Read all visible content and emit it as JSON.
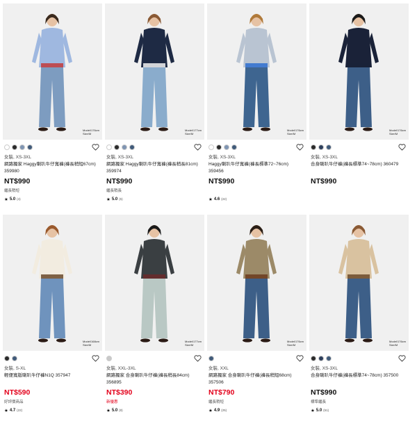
{
  "colors": {
    "sale_red": "#e3001b",
    "photo_bg": "#f0f0f0"
  },
  "products": [
    {
      "swatches": [
        "#ffffff",
        "#2b2b2b",
        "#7f95b3",
        "#415b7a"
      ],
      "sizes": "女裝, XS-3XL",
      "name": "網路獨家 Haggy喇叭牛仔寬褲(褲長稍短67cm) 359980",
      "price": "NT$990",
      "sale": false,
      "tag": "繼長稍短",
      "rating": "5.0",
      "reviews": "(4)",
      "model_note": "Model/176cm\nSize/M",
      "figure": {
        "top": "#9fb8e0",
        "bottom": "#7d9cc0",
        "hair": "#3a2a1e",
        "accent": "#c23a3a"
      }
    },
    {
      "swatches": [
        "#ffffff",
        "#2b2b2b",
        "#7f95b3",
        "#415b7a"
      ],
      "sizes": "女裝, XS-3XL",
      "name": "網路獨家 Haggy喇叭牛仔寬褲(褲長稍長81cm) 359974",
      "price": "NT$990",
      "sale": false,
      "tag": "繼長稍長",
      "rating": "5.0",
      "reviews": "(5)",
      "model_note": "Model/177cm\nSize/M",
      "figure": {
        "top": "#1e2a44",
        "bottom": "#8aaccc",
        "hair": "#8a5a35",
        "accent": "#f2f2f2"
      }
    },
    {
      "swatches": [
        "#ffffff",
        "#2b2b2b",
        "#7f95b3",
        "#415b7a"
      ],
      "sizes": "女裝, XS-3XL",
      "name": "Haggy喇叭牛仔寬褲(褲長標準72~76cm) 359456",
      "price": "NT$990",
      "sale": false,
      "tag": "",
      "rating": "4.6",
      "reviews": "(22)",
      "model_note": "Model/176cm\nSize/M",
      "figure": {
        "top": "#b9c4d2",
        "bottom": "#3e6590",
        "hair": "#b07a3a",
        "accent": "#2e6fd0"
      }
    },
    {
      "swatches": [
        "#2b2b2b",
        "#2e3f5c",
        "#415b7a"
      ],
      "sizes": "女裝, XS-3XL",
      "name": "合身喇叭牛仔褲(褲長標準74~78cm) 360479",
      "price": "NT$990",
      "sale": false,
      "tag": "",
      "rating": "",
      "reviews": "",
      "model_note": "Model/176cm\nSize/M",
      "figure": {
        "top": "#1a2238",
        "bottom": "#3d5f88",
        "hair": "#1a1a1a",
        "accent": "#1a2238"
      }
    },
    {
      "swatches": [
        "#2b2b2b",
        "#415b7a"
      ],
      "sizes": "女裝, S-XL",
      "name": "輕便寬版喇叭牛仔褲N1Q 357947",
      "price": "NT$590",
      "sale": true,
      "tag": "好評價商品",
      "rating": "4.7",
      "reviews": "(22)",
      "model_note": "Model/168cm\nSize/M",
      "figure": {
        "top": "#f2ece0",
        "bottom": "#6f93bd",
        "hair": "#9a5a2e",
        "accent": "#6b4a2a"
      }
    },
    {
      "swatches": [
        "#c9c9c9"
      ],
      "sizes": "女裝, XXL-3XL",
      "name": "網路獨家 合身喇叭牛仔褲(褲長稍長84cm) 356895",
      "price": "NT$390",
      "sale": true,
      "tag": "新優惠",
      "rating": "5.0",
      "reviews": "(8)",
      "model_note": "Model/177cm\nSize/M",
      "figure": {
        "top": "#3a3f42",
        "bottom": "#b9c8c4",
        "hair": "#1a1a1a",
        "accent": "#6b2a2a"
      }
    },
    {
      "swatches": [
        "#415b7a"
      ],
      "sizes": "女裝, XXL",
      "name": "網路獨家 合身喇叭牛仔褲(褲長稍短68cm) 357506",
      "price": "NT$790",
      "sale": true,
      "tag": "繼長稍短",
      "rating": "4.9",
      "reviews": "(25)",
      "model_note": "Model/176cm\nSize/M",
      "figure": {
        "top": "#9c8a68",
        "bottom": "#3d5f88",
        "hair": "#2a1e16",
        "accent": "#6b3a1e"
      }
    },
    {
      "swatches": [
        "#2b2b2b",
        "#2e3f5c",
        "#415b7a"
      ],
      "sizes": "女裝, XS-3XL",
      "name": "合身喇叭牛仔褲(褲長標準74~78cm) 357500",
      "price": "NT$990",
      "sale": false,
      "tag": "標準繼長",
      "rating": "5.0",
      "reviews": "(51)",
      "model_note": "Model/176cm\nSize/M",
      "figure": {
        "top": "#d9c2a0",
        "bottom": "#3d5f88",
        "hair": "#8a5a35",
        "accent": "#6b4a2a"
      }
    }
  ]
}
